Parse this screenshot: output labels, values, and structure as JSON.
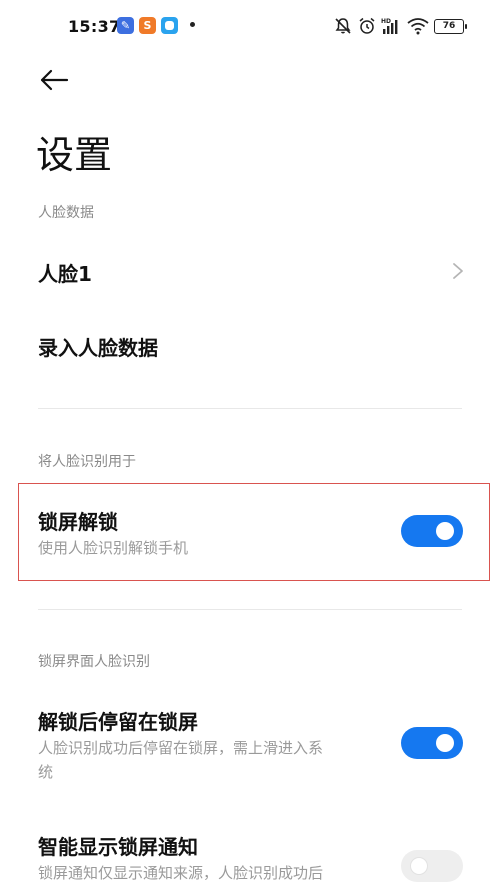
{
  "status_bar": {
    "time": "15:37",
    "app_icons": [
      "note-app-icon",
      "s-app-icon",
      "square-app-icon"
    ],
    "battery": "76",
    "icons": [
      "mute-icon",
      "alarm-icon",
      "hd-signal-icon",
      "wifi-icon",
      "battery-icon"
    ]
  },
  "header": {
    "title": "设置"
  },
  "face_data": {
    "header": "人脸数据",
    "face1_label": "人脸1",
    "enroll_label": "录入人脸数据"
  },
  "use_for": {
    "header": "将人脸识别用于",
    "lock_unlock": {
      "title": "锁屏解锁",
      "subtitle": "使用人脸识别解锁手机",
      "enabled": true
    }
  },
  "lockscreen": {
    "header": "锁屏界面人脸识别",
    "stay_on_lock": {
      "title": "解锁后停留在锁屏",
      "subtitle_line1": "人脸识别成功后停留在锁屏，需上滑进入系",
      "subtitle_line2": "统",
      "enabled": true
    },
    "smart_notify": {
      "title": "智能显示锁屏通知",
      "subtitle_line1": "锁屏通知仅显示通知来源，人脸识别成功后",
      "enabled": false
    }
  },
  "colors": {
    "accent": "#1578f0",
    "highlight": "#d9534f"
  }
}
